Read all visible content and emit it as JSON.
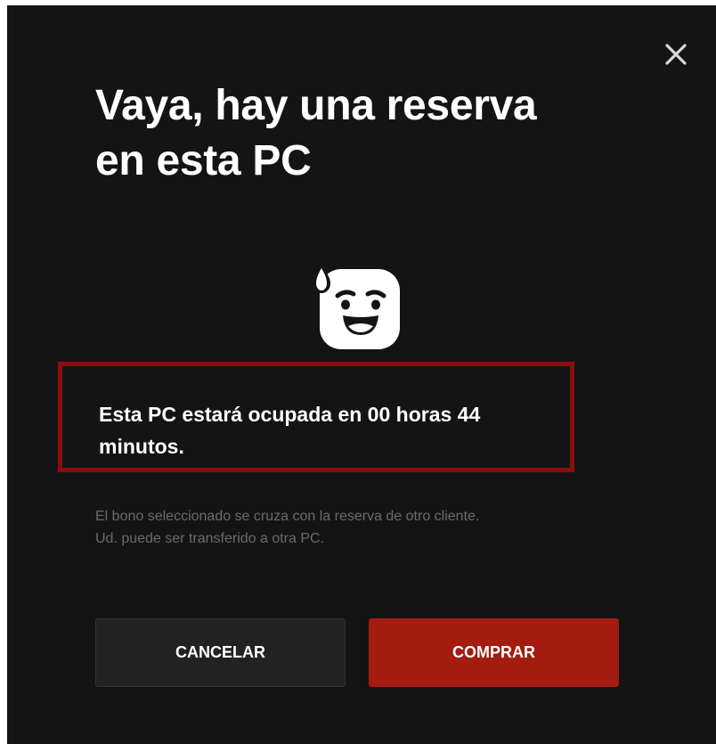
{
  "dialog": {
    "title_line1": "Vaya, hay una reserva",
    "title_line2": "en esta PC",
    "close_icon": "close-icon",
    "face_icon": "sweating-face-icon",
    "notice_line1": "Esta PC estará ocupada en 00 horas 44",
    "notice_line2": "minutos.",
    "info_line1": "El bono seleccionado se cruza con la reserva de otro cliente.",
    "info_line2": "Ud. puede ser transferido a otra PC.",
    "cancel_label": "CANCELAR",
    "buy_label": "COMPRAR"
  },
  "colors": {
    "background": "#141414",
    "highlight_border": "#8c0d0d",
    "primary_button": "#a41b10",
    "secondary_button": "#222222",
    "muted_text": "#6b6b6b"
  }
}
